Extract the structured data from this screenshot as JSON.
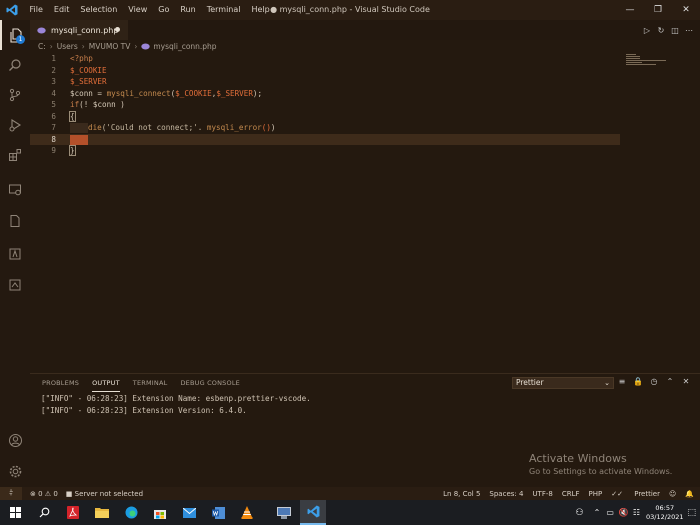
{
  "titlebar": {
    "menu": [
      "File",
      "Edit",
      "Selection",
      "View",
      "Go",
      "Run",
      "Terminal",
      "Help"
    ],
    "title": "● mysqli_conn.php - Visual Studio Code"
  },
  "activitybar": {
    "explorer_badge": "1"
  },
  "tab": {
    "label": "mysqli_conn.php"
  },
  "breadcrumb": {
    "parts": [
      "C:",
      "Users",
      "MVUMO",
      "TV",
      "mysqli_conn.php"
    ]
  },
  "editor": {
    "line_numbers": [
      "1",
      "2",
      "3",
      "4",
      "5",
      "6",
      "7",
      "8",
      "9"
    ],
    "code": {
      "l1": "<?php",
      "l2": "$_COOKIE",
      "l3": "$_SERVER",
      "l4_var": "$conn",
      "l4_eq": " = ",
      "l4_fn": "mysqli_connect",
      "l4_args_open": "(",
      "l4_arg1": "$_COOKIE",
      "l4_comma": ",",
      "l4_arg2": "$_SERVER",
      "l4_close": ");",
      "l5_kw": "if",
      "l5_rest": "(! $conn )",
      "l6": "{",
      "l7_fn": "die",
      "l7_str": "('Could not connect;'. ",
      "l7_fn2": "mysqli_error",
      "l7_parens": "()",
      "l7_close": ")",
      "l9": "}"
    }
  },
  "panel": {
    "tabs": [
      "PROBLEMS",
      "OUTPUT",
      "TERMINAL",
      "DEBUG CONSOLE"
    ],
    "active_tab": "OUTPUT",
    "output_channel": "Prettier",
    "lines": [
      "[\"INFO\" - 06:28:23] Extension Name: esbenp.prettier-vscode.",
      "[\"INFO\" - 06:28:23] Extension Version: 6.4.0."
    ]
  },
  "watermark": {
    "title": "Activate Windows",
    "subtitle": "Go to Settings to activate Windows."
  },
  "statusbar": {
    "errors": "0",
    "warnings": "0",
    "server": "Server not selected",
    "position": "Ln 8, Col 5",
    "spaces": "Spaces: 4",
    "encoding": "UTF-8",
    "eol": "CRLF",
    "language": "PHP",
    "formatter": "Prettier"
  },
  "taskbar": {
    "time": "06:57",
    "date": "03/12/2021"
  },
  "colors": {
    "background": "#24190f",
    "current_line": "#3e2b1a",
    "cursor_block": "#b3502a",
    "variable": "#e26e3a",
    "accent_blue": "#1f7bd4"
  }
}
